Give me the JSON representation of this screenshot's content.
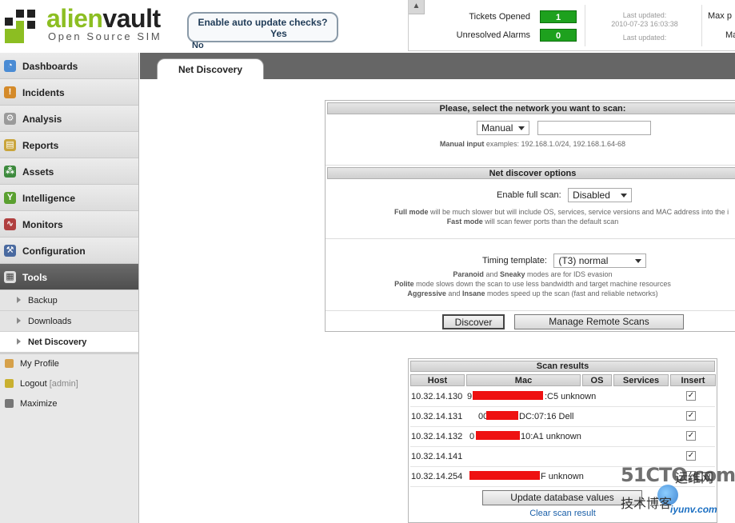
{
  "brand": {
    "name_part1": "alien",
    "name_part2": "vault",
    "subtitle": "Open Source SIM"
  },
  "update_prompt": {
    "question": "Enable auto update checks?",
    "yes": "Yes",
    "no": "No"
  },
  "stats": {
    "tab_icon": "▲",
    "tickets_opened": {
      "label": "Tickets Opened",
      "count": "1"
    },
    "unresolved_alarms": {
      "label": "Unresolved Alarms",
      "count": "0"
    },
    "last_updated_label": "Last updated:",
    "last_updated_value": "2010-07-23 16:03:38",
    "last_updated_label2": "Last updated:",
    "max_label": "Max p",
    "max_label2": "Ma"
  },
  "sidebar": {
    "items": [
      {
        "label": "Dashboards",
        "icon": "dashboards-icon",
        "color": "#4a8bd4"
      },
      {
        "label": "Incidents",
        "icon": "incidents-icon",
        "color": "#d48a2a"
      },
      {
        "label": "Analysis",
        "icon": "analysis-icon",
        "color": "#8a8a8a"
      },
      {
        "label": "Reports",
        "icon": "reports-icon",
        "color": "#c9a43a"
      },
      {
        "label": "Assets",
        "icon": "assets-icon",
        "color": "#3d8a3d"
      },
      {
        "label": "Intelligence",
        "icon": "intelligence-icon",
        "color": "#5aa030"
      },
      {
        "label": "Monitors",
        "icon": "monitors-icon",
        "color": "#b04040"
      },
      {
        "label": "Configuration",
        "icon": "configuration-icon",
        "color": "#4a6aa0"
      },
      {
        "label": "Tools",
        "icon": "tools-icon",
        "color": "#dddddd"
      }
    ],
    "tools_sub": [
      {
        "label": "Backup"
      },
      {
        "label": "Downloads"
      },
      {
        "label": "Net Discovery"
      }
    ],
    "extra": {
      "profile": "My Profile",
      "logout": "Logout",
      "logout_user": "[admin]",
      "maximize": "Maximize"
    }
  },
  "tab": {
    "label": "Net Discovery"
  },
  "network_section": {
    "title": "Please, select the network you want to scan:",
    "mode_value": "Manual",
    "network_value": "",
    "hint_bold": "Manual input",
    "hint_text": " examples: 192.168.1.0/24, 192.168.1.64-68"
  },
  "options_section": {
    "title": "Net discover options",
    "full_scan_label": "Enable full scan:",
    "full_scan_value": "Disabled",
    "full_hint1_bold": "Full mode",
    "full_hint1_text": " will be much slower but will include OS, services, service versions and MAC address into the i",
    "full_hint2_bold": "Fast mode",
    "full_hint2_text": " will scan fewer ports than the default scan",
    "timing_label": "Timing template:",
    "timing_value": "(T3) normal",
    "timing_hint1_b1": "Paranoid",
    "timing_hint1_t1": " and ",
    "timing_hint1_b2": "Sneaky",
    "timing_hint1_t2": " modes are for IDS evasion",
    "timing_hint2_bold": "Polite",
    "timing_hint2_text": " mode slows down the scan to use less bandwidth and target machine resources",
    "timing_hint3_b1": "Aggressive",
    "timing_hint3_t1": " and ",
    "timing_hint3_b2": "Insane",
    "timing_hint3_t2": " modes speed up the scan (fast and reliable networks)"
  },
  "buttons": {
    "discover": "Discover",
    "manage_remote": "Manage Remote Scans",
    "update_db": "Update database values",
    "clear": "Clear scan result"
  },
  "results": {
    "title": "Scan results",
    "columns": [
      "Host",
      "Mac",
      "OS",
      "Services",
      "Insert"
    ],
    "rows": [
      {
        "host": "10.32.14.130",
        "mac_prefix": "9",
        "mac_suffix": ":C5 unknown",
        "checked": "✓"
      },
      {
        "host": "10.32.14.131",
        "mac_prefix": "00",
        "mac_suffix": "DC:07:16 Dell",
        "checked": "✓"
      },
      {
        "host": "10.32.14.132",
        "mac_prefix": "0",
        "mac_suffix": "10:A1 unknown",
        "checked": "✓"
      },
      {
        "host": "10.32.14.141",
        "mac_prefix": "",
        "mac_suffix": "",
        "checked": "✓"
      },
      {
        "host": "10.32.14.254",
        "mac_prefix": "",
        "mac_suffix": "F unknown",
        "checked": ""
      }
    ]
  },
  "watermark": {
    "site": "51CTO.com",
    "l1": "运维网",
    "l2": "技术博客",
    "url": "iyunv.com"
  }
}
